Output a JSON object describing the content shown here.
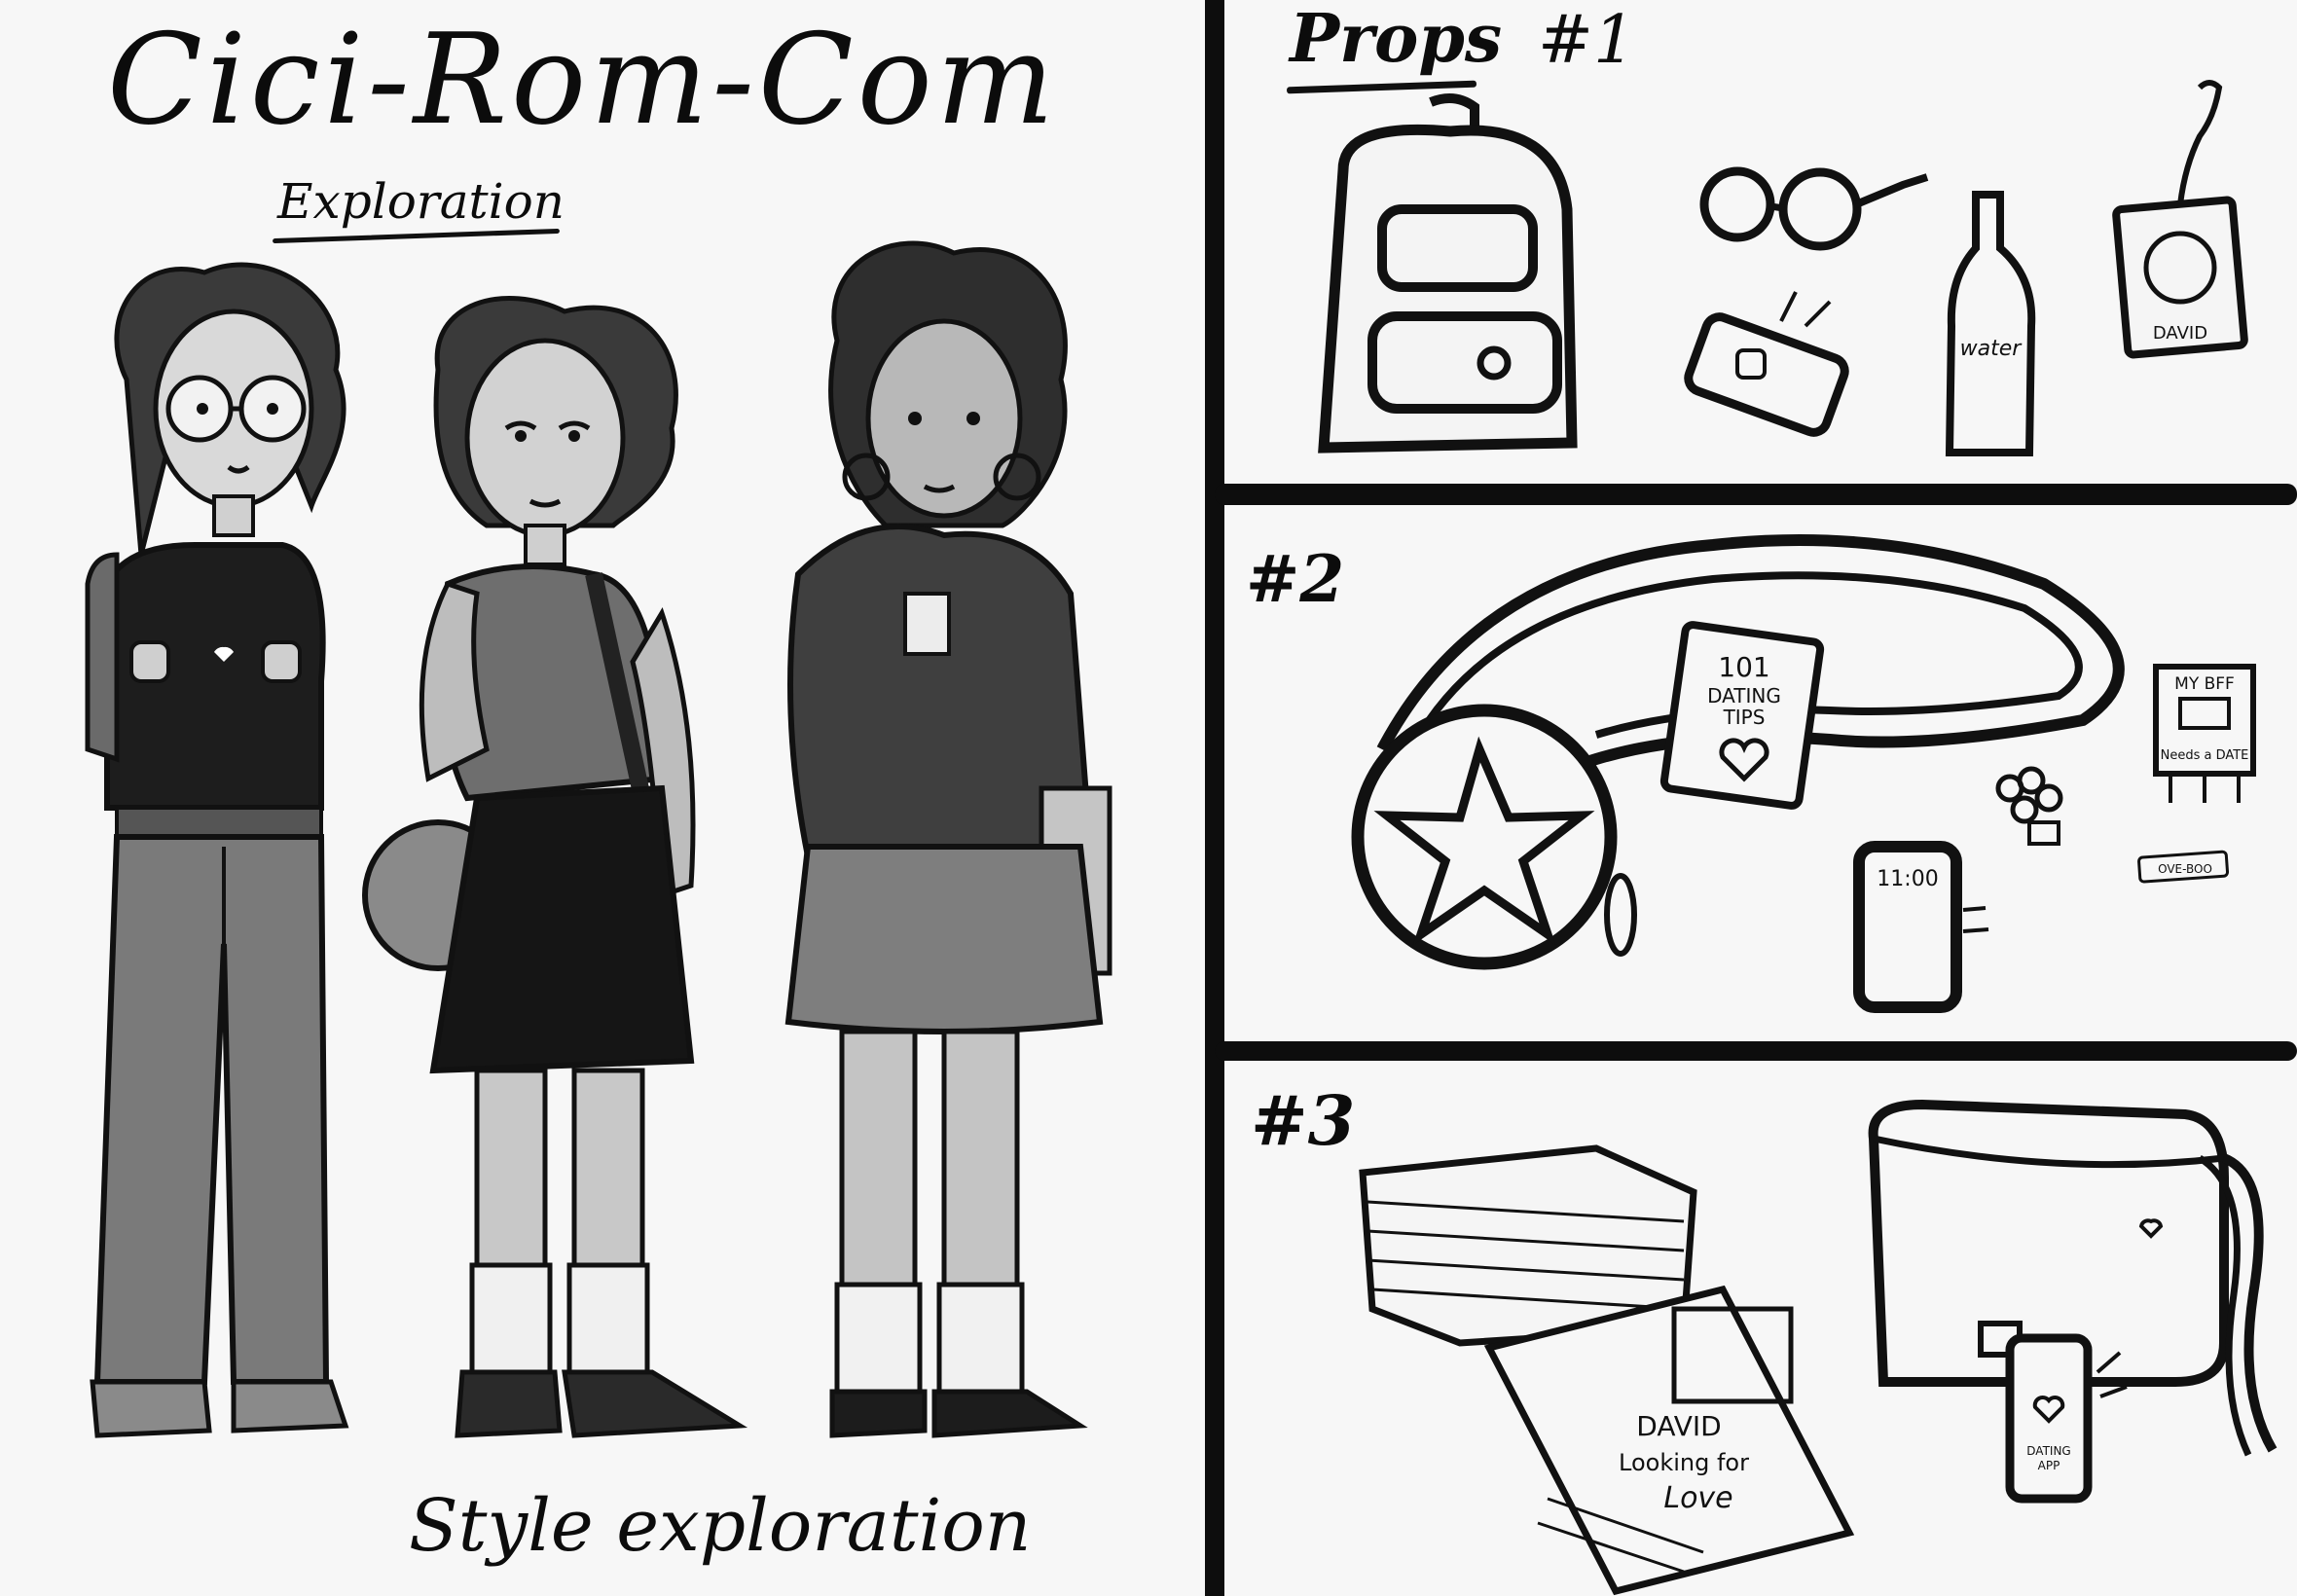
{
  "sheet": {
    "title": "Cici-Rom-Com",
    "subtitle": "Exploration",
    "footer": "Style exploration"
  },
  "props": {
    "heading": "Props",
    "section1": "#1",
    "section2": "#2",
    "section3": "#3"
  },
  "labels": {
    "water": "water",
    "photo_name": "DAVID",
    "book_number": "101",
    "book_line1": "DATING",
    "book_line2": "TIPS",
    "flyer_line1": "MY BFF",
    "flyer_line2": "Needs a DATE",
    "phone_time": "11:00",
    "ticket": "OVE-BOO",
    "poster_name": "DAVID",
    "poster_line1": "Looking for",
    "poster_line2": "Love",
    "app_line1": "DATING",
    "app_line2": "APP"
  },
  "colors": {
    "ink": "#0c0c0c",
    "paper": "#f7f7f7",
    "dark_gray": "#3a3a3a",
    "mid_gray": "#7a7a7a",
    "light_gray": "#bdbdbd"
  }
}
